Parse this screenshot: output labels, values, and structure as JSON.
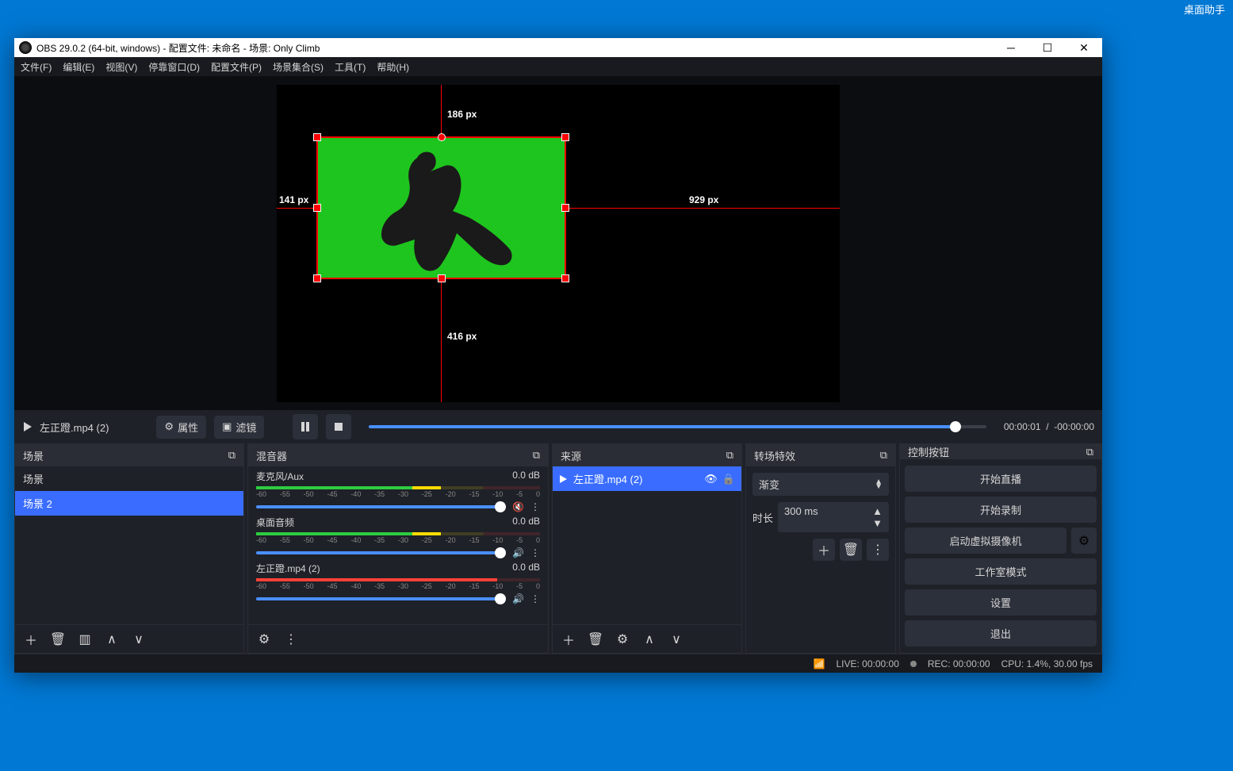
{
  "desktop": {
    "assistant": "桌面助手"
  },
  "window": {
    "title": "OBS 29.0.2 (64-bit, windows) - 配置文件: 未命名 - 场景: Only Climb"
  },
  "menu": {
    "file": "文件(F)",
    "edit": "编辑(E)",
    "view": "视图(V)",
    "dock": "停靠窗口(D)",
    "profile": "配置文件(P)",
    "scenes": "场景集合(S)",
    "tools": "工具(T)",
    "help": "帮助(H)"
  },
  "preview": {
    "guides": {
      "top": "186 px",
      "left": "141 px",
      "right": "929 px",
      "bottom": "416 px"
    }
  },
  "mediabar": {
    "source": "左正蹬.mp4 (2)",
    "props": "属性",
    "filters": "滤镜",
    "time_cur": "00:00:01",
    "time_sep": "/",
    "time_rem": "-00:00:00"
  },
  "docks": {
    "scenes": {
      "title": "场景",
      "items": [
        "场景",
        "场景 2"
      ]
    },
    "mixer": {
      "title": "混音器",
      "tracks": [
        {
          "name": "麦克风/Aux",
          "db": "0.0 dB",
          "muted": true
        },
        {
          "name": "桌面音频",
          "db": "0.0 dB",
          "muted": false
        },
        {
          "name": "左正蹬.mp4 (2)",
          "db": "0.0 dB",
          "muted": false
        }
      ],
      "ticks": [
        "-60",
        "-55",
        "-50",
        "-45",
        "-40",
        "-35",
        "-30",
        "-25",
        "-20",
        "-15",
        "-10",
        "-5",
        "0"
      ]
    },
    "sources": {
      "title": "来源",
      "items": [
        {
          "name": "左正蹬.mp4 (2)"
        }
      ]
    },
    "trans": {
      "title": "转场特效",
      "select": "渐变",
      "dur_label": "时长",
      "dur_value": "300 ms"
    },
    "controls": {
      "title": "控制按钮",
      "buttons": {
        "stream": "开始直播",
        "record": "开始录制",
        "vcam": "启动虚拟摄像机",
        "studio": "工作室模式",
        "settings": "设置",
        "exit": "退出"
      }
    }
  },
  "status": {
    "live": "LIVE: 00:00:00",
    "rec": "REC: 00:00:00",
    "cpu": "CPU: 1.4%, 30.00 fps"
  }
}
